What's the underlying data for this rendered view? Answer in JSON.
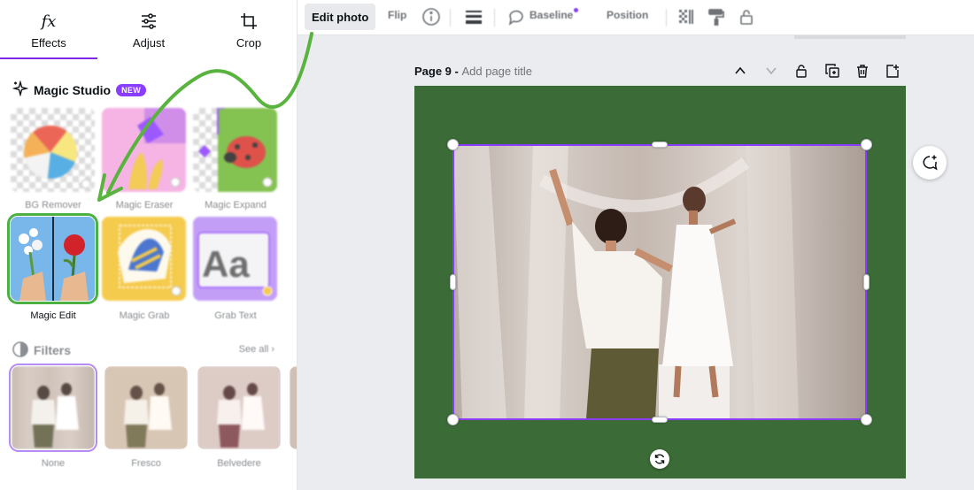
{
  "tabs": [
    {
      "label": "Effects",
      "icon": "fx-icon"
    },
    {
      "label": "Adjust",
      "icon": "sliders-icon"
    },
    {
      "label": "Crop",
      "icon": "crop-icon"
    }
  ],
  "magic_studio": {
    "title": "Magic Studio",
    "badge": "NEW",
    "tools": [
      {
        "label": "BG Remover"
      },
      {
        "label": "Magic Eraser"
      },
      {
        "label": "Magic Expand"
      },
      {
        "label": "Magic Edit"
      },
      {
        "label": "Magic Grab"
      },
      {
        "label": "Grab Text"
      }
    ],
    "grab_text_sample": "Aa"
  },
  "filters": {
    "title": "Filters",
    "see_all": "See all",
    "items": [
      {
        "label": "None"
      },
      {
        "label": "Fresco"
      },
      {
        "label": "Belvedere"
      }
    ]
  },
  "toolbar": {
    "edit_photo": "Edit photo",
    "flip": "Flip",
    "baseline": "Baseline",
    "position": "Position"
  },
  "page": {
    "label": "Page 9 - ",
    "placeholder": "Add page title"
  },
  "colors": {
    "accent": "#8b3dff",
    "page_background": "#3b6b36",
    "highlight": "#4cb043"
  }
}
